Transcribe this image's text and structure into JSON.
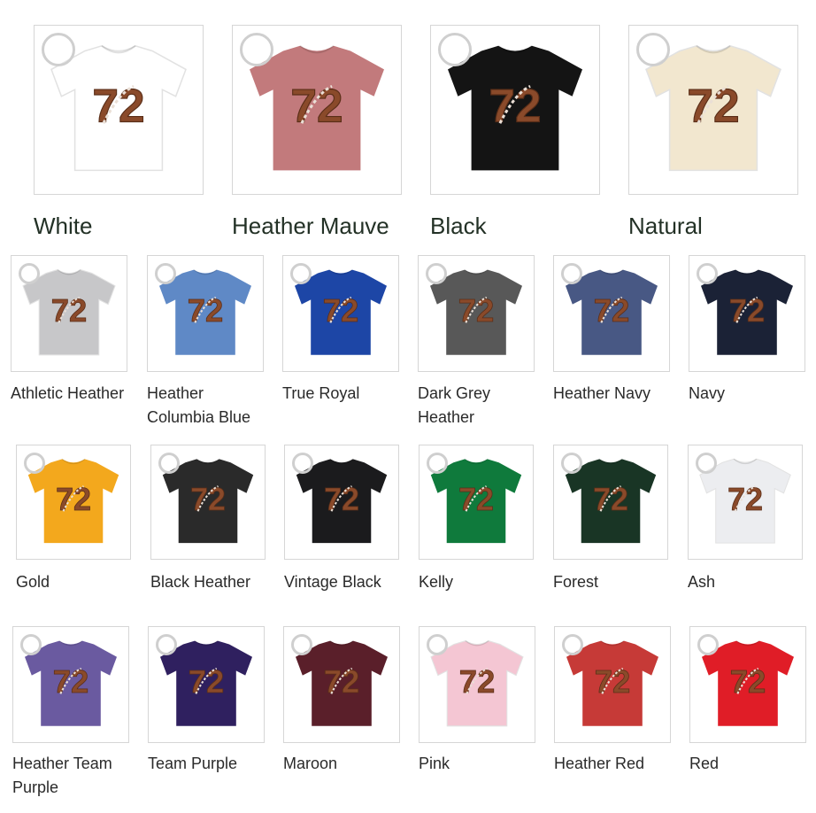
{
  "swatches": [
    {
      "name": "White",
      "color": "#ffffff"
    },
    {
      "name": "Heather Mauve",
      "color": "#c27a7c"
    },
    {
      "name": "Black",
      "color": "#141414"
    },
    {
      "name": "Natural",
      "color": "#f2e7cf"
    },
    {
      "name": "Athletic Heather",
      "color": "#c7c7c9"
    },
    {
      "name": "Heather Columbia Blue",
      "color": "#5f89c6"
    },
    {
      "name": "True Royal",
      "color": "#1d46a6"
    },
    {
      "name": "Dark Grey Heather",
      "color": "#585858"
    },
    {
      "name": "Heather Navy",
      "color": "#485884"
    },
    {
      "name": "Navy",
      "color": "#1b2236"
    },
    {
      "name": "Gold",
      "color": "#f3a81d"
    },
    {
      "name": "Black Heather",
      "color": "#2a2a2a"
    },
    {
      "name": "Vintage Black",
      "color": "#1b1b1d"
    },
    {
      "name": "Kelly",
      "color": "#0f7a3c"
    },
    {
      "name": "Forest",
      "color": "#193525"
    },
    {
      "name": "Ash",
      "color": "#ecedf0"
    },
    {
      "name": "Heather Team Purple",
      "color": "#6a5aa0"
    },
    {
      "name": "Team Purple",
      "color": "#2f205f"
    },
    {
      "name": "Maroon",
      "color": "#5a1f2a"
    },
    {
      "name": "Pink",
      "color": "#f4c6d3"
    },
    {
      "name": "Heather Red",
      "color": "#c63a37"
    },
    {
      "name": "Red",
      "color": "#e01d27"
    }
  ],
  "design": {
    "number": "72",
    "number_color": "#8a4a2a"
  }
}
